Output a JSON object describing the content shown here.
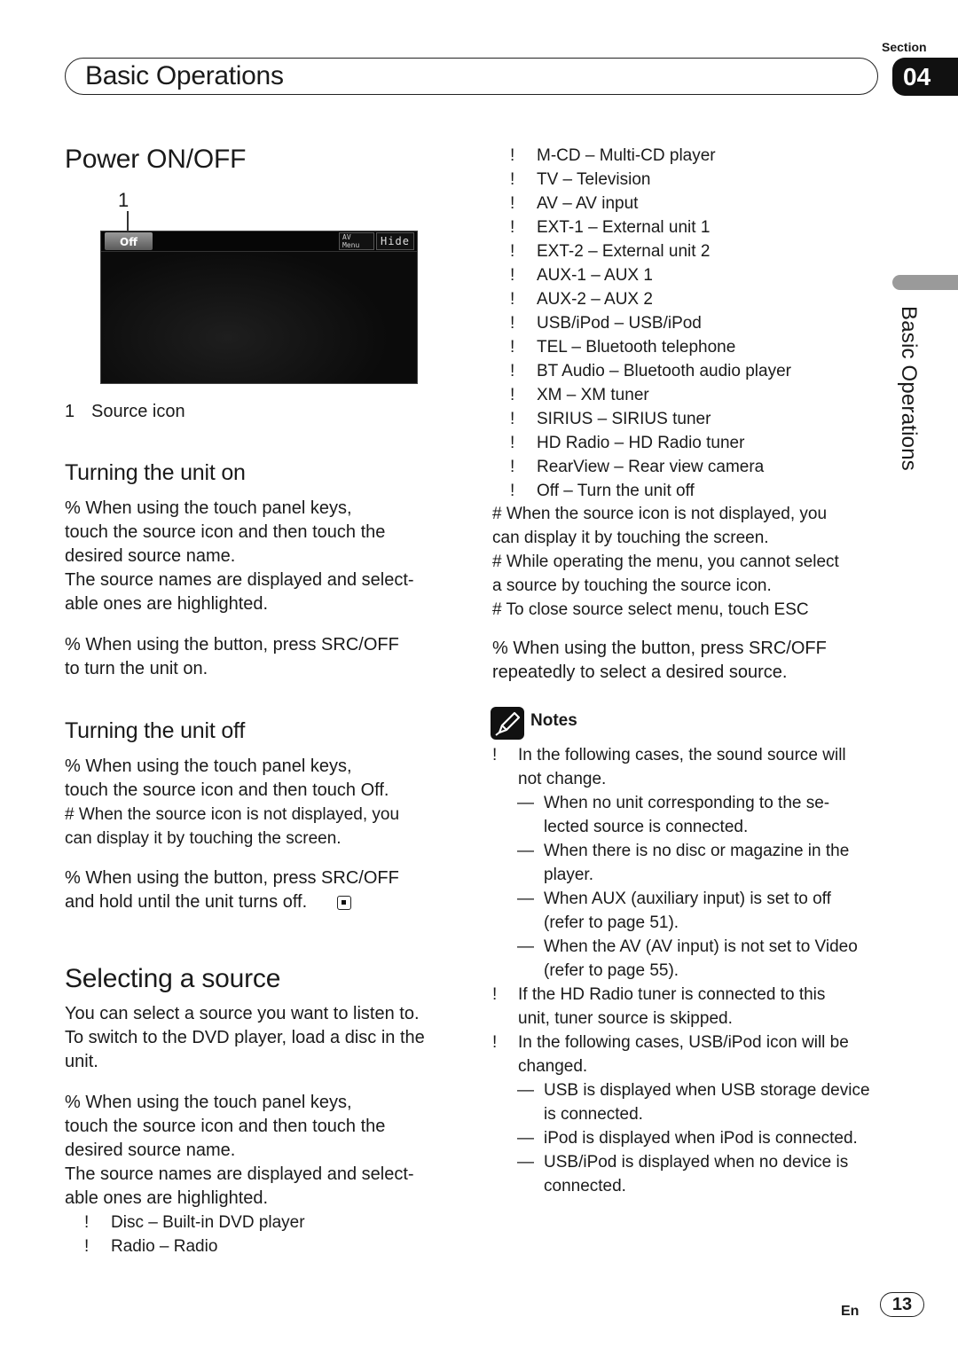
{
  "header": {
    "title": "Basic Operations",
    "section_label": "Section",
    "section_number": "04",
    "side_tab_text": "Basic Operations"
  },
  "left": {
    "power_title": "Power ON/OFF",
    "figure": {
      "callout_number": "1",
      "screen_buttons": {
        "off": "Off",
        "av_menu_line1": "AV",
        "av_menu_line2": "Menu",
        "hide": "Hide"
      },
      "caption_number": "1",
      "caption_text": "Source icon"
    },
    "turn_on": {
      "title": "Turning the unit on",
      "lines": [
        "%   When using the touch panel keys,",
        "touch the source icon and then touch the",
        "desired source name.",
        "The source names are displayed and select-",
        "able ones are highlighted."
      ],
      "button_lines": [
        "%   When using the button, press SRC/OFF",
        "to turn the unit on."
      ]
    },
    "turn_off": {
      "title": "Turning the unit off",
      "lines": [
        "%   When using the touch panel keys,",
        "touch the source icon and then touch Off."
      ],
      "note_lines": [
        "#   When the source icon is not displayed, you",
        "can display it by touching the screen."
      ],
      "button_lines": [
        "%   When using the button, press SRC/OFF",
        "and hold until the unit turns off."
      ]
    },
    "select": {
      "title": "Selecting a source",
      "intro": [
        "You can select a source you want to listen to.",
        "To switch to the DVD player, load a disc in the",
        "unit."
      ],
      "lines": [
        "%   When using the touch panel keys,",
        "touch the source icon and then touch the",
        "desired source name.",
        "The source names are displayed and select-",
        "able ones are highlighted."
      ],
      "sources": [
        {
          "bullet": "!",
          "text": "Disc – Built-in DVD player"
        },
        {
          "bullet": "!",
          "text": "Radio – Radio"
        }
      ]
    }
  },
  "right": {
    "sources": [
      {
        "bullet": "!",
        "text": "M-CD – Multi-CD player"
      },
      {
        "bullet": "!",
        "text": "TV – Television"
      },
      {
        "bullet": "!",
        "text": "AV – AV input"
      },
      {
        "bullet": "!",
        "text": "EXT-1 – External unit 1"
      },
      {
        "bullet": "!",
        "text": "EXT-2 – External unit 2"
      },
      {
        "bullet": "!",
        "text": "AUX-1 – AUX 1"
      },
      {
        "bullet": "!",
        "text": "AUX-2 – AUX 2"
      },
      {
        "bullet": "!",
        "text": "USB/iPod – USB/iPod"
      },
      {
        "bullet": "!",
        "text": "TEL – Bluetooth telephone"
      },
      {
        "bullet": "!",
        "text": "BT Audio – Bluetooth audio player"
      },
      {
        "bullet": "!",
        "text": "XM – XM tuner"
      },
      {
        "bullet": "!",
        "text": "SIRIUS – SIRIUS tuner"
      },
      {
        "bullet": "!",
        "text": "HD Radio – HD Radio tuner"
      },
      {
        "bullet": "!",
        "text": "RearView – Rear view camera"
      },
      {
        "bullet": "!",
        "text": "Off – Turn the unit off"
      }
    ],
    "hash_notes": [
      "#   When the source icon is not displayed, you",
      "can display it by touching the screen.",
      "#   While operating the menu, you cannot select",
      "a source by touching the source icon.",
      "#   To close source select menu, touch ESC"
    ],
    "button_lines": [
      "%   When using the button, press SRC/OFF",
      "repeatedly to select a desired source."
    ],
    "notes": {
      "title": "Notes",
      "lines": [
        {
          "mark": "!",
          "text": "In the following cases, the sound source will",
          "indent": 1
        },
        {
          "mark": "",
          "text": "not change.",
          "indent": 1
        },
        {
          "mark": "—",
          "text": "When no unit corresponding to the se-",
          "indent": 2
        },
        {
          "mark": "",
          "text": "lected source is connected.",
          "indent": 2
        },
        {
          "mark": "—",
          "text": "When there is no disc or magazine in the",
          "indent": 2
        },
        {
          "mark": "",
          "text": "player.",
          "indent": 2
        },
        {
          "mark": "—",
          "text": "When AUX (auxiliary input) is set to off",
          "indent": 2
        },
        {
          "mark": "",
          "text": "(refer to page 51).",
          "indent": 2
        },
        {
          "mark": "—",
          "text": "When the AV (AV input) is not set to Video",
          "indent": 2
        },
        {
          "mark": "",
          "text": "(refer to page 55).",
          "indent": 2
        },
        {
          "mark": "!",
          "text": "If the HD Radio tuner is connected to this",
          "indent": 1
        },
        {
          "mark": "",
          "text": "unit, tuner source is skipped.",
          "indent": 1
        },
        {
          "mark": "!",
          "text": "In the following cases, USB/iPod icon will be",
          "indent": 1
        },
        {
          "mark": "",
          "text": "changed.",
          "indent": 1
        },
        {
          "mark": "—",
          "text": "USB is displayed when USB storage device",
          "indent": 2
        },
        {
          "mark": "",
          "text": "is connected.",
          "indent": 2
        },
        {
          "mark": "—",
          "text": "iPod is displayed when iPod is connected.",
          "indent": 2
        },
        {
          "mark": "—",
          "text": "USB/iPod is displayed when no device is",
          "indent": 2
        },
        {
          "mark": "",
          "text": "connected.",
          "indent": 2
        }
      ]
    }
  },
  "footer": {
    "language": "En",
    "page_number": "13"
  }
}
